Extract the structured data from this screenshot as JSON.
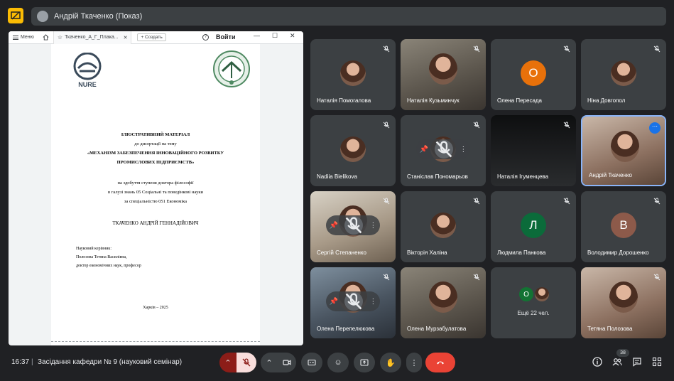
{
  "header": {
    "presenter_label": "Андрій Ткаченко (Показ)"
  },
  "document_window": {
    "menu_label": "Меню",
    "tab_title": "Ткаченко_А_Г_Плака...",
    "new_tab_label": "+ Создать",
    "login_label": "Войти",
    "page": {
      "logo_left_text": "NURE",
      "line1": "ІЛЮСТРАТИВНИЙ МАТЕРІАЛ",
      "line2": "до дисертації на тему",
      "line3": "«МЕХАНІЗМ ЗАБЕЗПЕЧЕННЯ ІННОВАЦІЙНОГО РОЗВИТКУ",
      "line4": "ПРОМИСЛОВИХ ПІДПРИЄМСТВ»",
      "line5": "на здобуття ступеня доктора філософії",
      "line6": "в галузі знань 05 Соціальні та поведінкові науки",
      "line7": "за спеціальністю 051 Економіка",
      "author": "ТКАЧЕНКО АНДРІЙ ГЕННАДІЙОВИЧ",
      "supervisor_label": "Науковий керівник:",
      "supervisor_name": "Полозова Тетяна Василівна,",
      "supervisor_title": "доктор економічних наук, професор",
      "place_year": "Харків – 2025"
    }
  },
  "participants": [
    {
      "name": "Наталія Помогалова",
      "type": "photo"
    },
    {
      "name": "Наталія Кузьминчук",
      "type": "video"
    },
    {
      "name": "Олена Пересада",
      "type": "letter",
      "letter": "О",
      "color": "#e8710a"
    },
    {
      "name": "Ніна Довгопол",
      "type": "photo"
    },
    {
      "name": "Nadiia Bielikova",
      "type": "photo"
    },
    {
      "name": "Станіслав Пономарьов",
      "type": "controls"
    },
    {
      "name": "Наталія Ігуменцева",
      "type": "dark"
    },
    {
      "name": "Андрій Ткаченко",
      "type": "video-active"
    },
    {
      "name": "Сергій Степаненко",
      "type": "video"
    },
    {
      "name": "Вікторія Халіна",
      "type": "photo"
    },
    {
      "name": "Людмила Панкова",
      "type": "letter",
      "letter": "Л",
      "color": "#0b6b3a"
    },
    {
      "name": "Володимир Дорошенко",
      "type": "letter",
      "letter": "В",
      "color": "#8d5a4a"
    },
    {
      "name": "Олена Перепелюкова",
      "type": "video"
    },
    {
      "name": "Олена Мурзабулатова",
      "type": "video"
    },
    {
      "name": "",
      "type": "extra",
      "letter": "О",
      "color": "#137333",
      "extra_label": "Ещё 22 чел."
    },
    {
      "name": "Тетяна Полозова",
      "type": "video"
    }
  ],
  "footer": {
    "time": "16:37",
    "separator": "|",
    "meeting_title": "Засідання кафедри № 9 (науковий семінар)",
    "participant_count": "38"
  },
  "colors": {
    "background": "#202124",
    "tile": "#3c4043",
    "end_call": "#ea4335",
    "accent": "#8ab4f8"
  }
}
